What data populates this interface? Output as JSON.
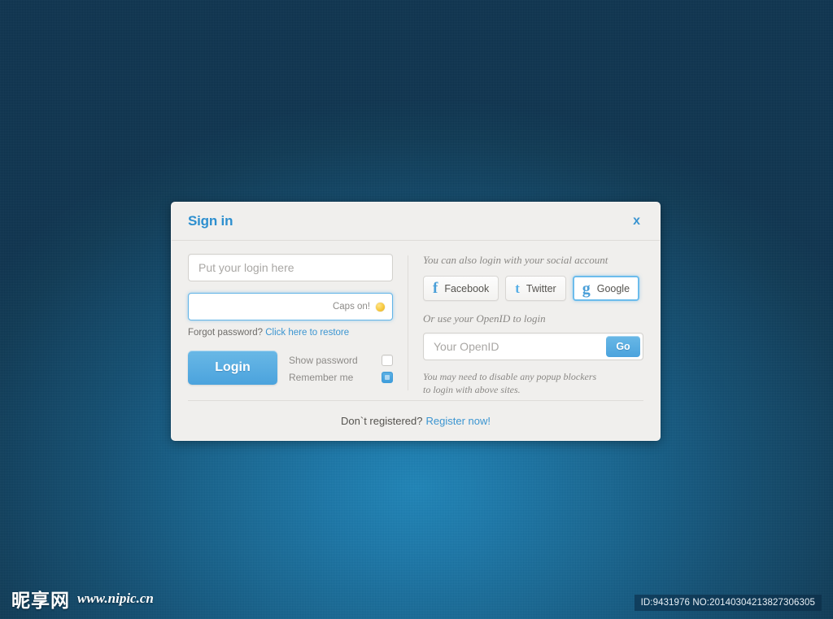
{
  "dialog": {
    "title": "Sign in",
    "close_label": "x",
    "login": {
      "username_placeholder": "Put your login here",
      "username_value": "",
      "password_placeholder": "",
      "password_value": "",
      "caps_warning": "Caps on!",
      "forgot_text": "Forgot password?",
      "forgot_link": "Click here to restore",
      "login_button": "Login",
      "show_password_label": "Show password",
      "show_password_checked": false,
      "remember_me_label": "Remember me",
      "remember_me_checked": true
    },
    "social": {
      "heading": "You can also login with your social account",
      "buttons": [
        {
          "label": "Facebook",
          "glyph": "f",
          "focused": false
        },
        {
          "label": "Twitter",
          "glyph": "t",
          "focused": false
        },
        {
          "label": "Google",
          "glyph": "g",
          "focused": true
        }
      ]
    },
    "openid": {
      "heading": "Or use your OpenID to login",
      "placeholder": "Your OpenID",
      "value": "",
      "go_label": "Go",
      "note_line1": "You may need to disable any popup blockers",
      "note_line2": "to login with above sites."
    },
    "footer": {
      "text": "Don`t registered?",
      "link": "Register now!"
    }
  },
  "watermark": {
    "brand_cn": "昵享网",
    "url": "www.nipic.cn",
    "id_text": "ID:9431976 NO:20140304213827306305"
  },
  "colors": {
    "accent": "#3b95d1",
    "button": "#4ba3dd",
    "caps_dot": "#f7c93f",
    "dialog_bg": "#f0efed",
    "background_center": "#1f85b8",
    "background_edge": "#0e3450"
  }
}
